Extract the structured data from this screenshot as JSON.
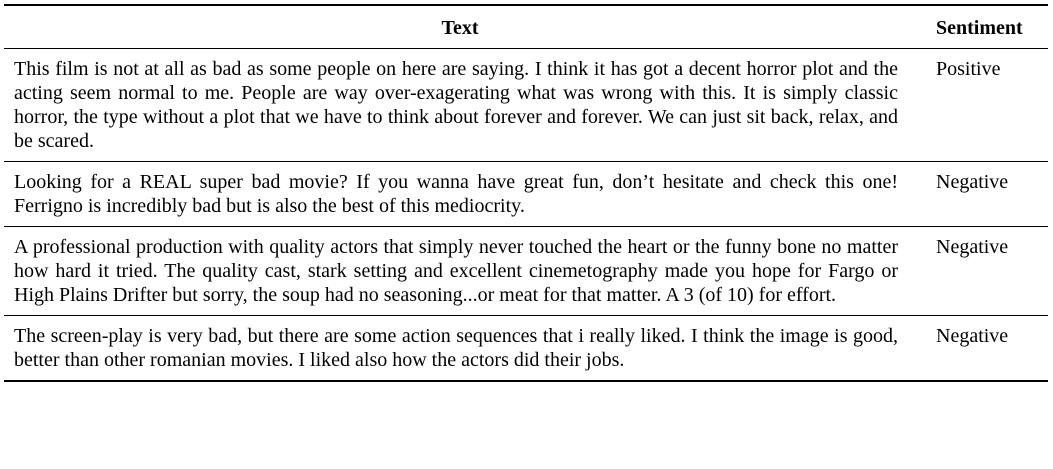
{
  "table": {
    "headers": {
      "text": "Text",
      "sentiment": "Sentiment"
    },
    "rows": [
      {
        "text": "This film is not at all as bad as some people on here are saying. I think it has got a decent horror plot and the acting seem normal to me. People are way over-exagerating what was wrong with this. It is simply classic horror, the type without a plot that we have to think about forever and forever. We can just sit back, relax, and be scared.",
        "sentiment": "Positive"
      },
      {
        "text": "Looking for a REAL super bad movie? If you wanna have great fun, don’t hesitate and check this one! Ferrigno is incredibly bad but is also the best of this mediocrity.",
        "sentiment": "Negative"
      },
      {
        "text": "A professional production with quality actors that simply never touched the heart or the funny bone no matter how hard it tried. The quality cast, stark setting and excellent cinemetography made you hope for Fargo or High Plains Drifter but sorry, the soup had no seasoning...or meat for that matter. A 3 (of 10) for effort.",
        "sentiment": "Negative"
      },
      {
        "text": "The screen-play is very bad, but there are some action sequences that i really liked. I think the image is good, better than other romanian movies. I liked also how the actors did their jobs.",
        "sentiment": "Negative"
      }
    ]
  }
}
